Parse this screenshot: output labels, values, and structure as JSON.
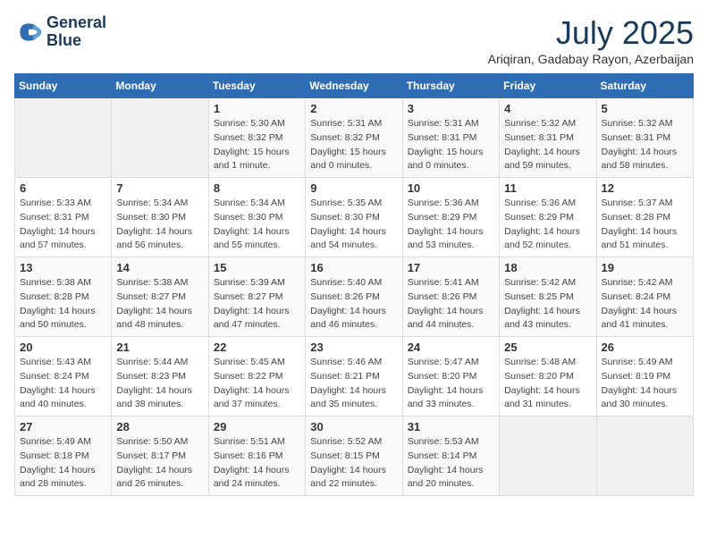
{
  "logo": {
    "line1": "General",
    "line2": "Blue"
  },
  "title": "July 2025",
  "subtitle": "Ariqiran, Gadabay Rayon, Azerbaijan",
  "days_header": [
    "Sunday",
    "Monday",
    "Tuesday",
    "Wednesday",
    "Thursday",
    "Friday",
    "Saturday"
  ],
  "weeks": [
    [
      {
        "num": "",
        "sunrise": "",
        "sunset": "",
        "daylight": ""
      },
      {
        "num": "",
        "sunrise": "",
        "sunset": "",
        "daylight": ""
      },
      {
        "num": "1",
        "sunrise": "Sunrise: 5:30 AM",
        "sunset": "Sunset: 8:32 PM",
        "daylight": "Daylight: 15 hours and 1 minute."
      },
      {
        "num": "2",
        "sunrise": "Sunrise: 5:31 AM",
        "sunset": "Sunset: 8:32 PM",
        "daylight": "Daylight: 15 hours and 0 minutes."
      },
      {
        "num": "3",
        "sunrise": "Sunrise: 5:31 AM",
        "sunset": "Sunset: 8:31 PM",
        "daylight": "Daylight: 15 hours and 0 minutes."
      },
      {
        "num": "4",
        "sunrise": "Sunrise: 5:32 AM",
        "sunset": "Sunset: 8:31 PM",
        "daylight": "Daylight: 14 hours and 59 minutes."
      },
      {
        "num": "5",
        "sunrise": "Sunrise: 5:32 AM",
        "sunset": "Sunset: 8:31 PM",
        "daylight": "Daylight: 14 hours and 58 minutes."
      }
    ],
    [
      {
        "num": "6",
        "sunrise": "Sunrise: 5:33 AM",
        "sunset": "Sunset: 8:31 PM",
        "daylight": "Daylight: 14 hours and 57 minutes."
      },
      {
        "num": "7",
        "sunrise": "Sunrise: 5:34 AM",
        "sunset": "Sunset: 8:30 PM",
        "daylight": "Daylight: 14 hours and 56 minutes."
      },
      {
        "num": "8",
        "sunrise": "Sunrise: 5:34 AM",
        "sunset": "Sunset: 8:30 PM",
        "daylight": "Daylight: 14 hours and 55 minutes."
      },
      {
        "num": "9",
        "sunrise": "Sunrise: 5:35 AM",
        "sunset": "Sunset: 8:30 PM",
        "daylight": "Daylight: 14 hours and 54 minutes."
      },
      {
        "num": "10",
        "sunrise": "Sunrise: 5:36 AM",
        "sunset": "Sunset: 8:29 PM",
        "daylight": "Daylight: 14 hours and 53 minutes."
      },
      {
        "num": "11",
        "sunrise": "Sunrise: 5:36 AM",
        "sunset": "Sunset: 8:29 PM",
        "daylight": "Daylight: 14 hours and 52 minutes."
      },
      {
        "num": "12",
        "sunrise": "Sunrise: 5:37 AM",
        "sunset": "Sunset: 8:28 PM",
        "daylight": "Daylight: 14 hours and 51 minutes."
      }
    ],
    [
      {
        "num": "13",
        "sunrise": "Sunrise: 5:38 AM",
        "sunset": "Sunset: 8:28 PM",
        "daylight": "Daylight: 14 hours and 50 minutes."
      },
      {
        "num": "14",
        "sunrise": "Sunrise: 5:38 AM",
        "sunset": "Sunset: 8:27 PM",
        "daylight": "Daylight: 14 hours and 48 minutes."
      },
      {
        "num": "15",
        "sunrise": "Sunrise: 5:39 AM",
        "sunset": "Sunset: 8:27 PM",
        "daylight": "Daylight: 14 hours and 47 minutes."
      },
      {
        "num": "16",
        "sunrise": "Sunrise: 5:40 AM",
        "sunset": "Sunset: 8:26 PM",
        "daylight": "Daylight: 14 hours and 46 minutes."
      },
      {
        "num": "17",
        "sunrise": "Sunrise: 5:41 AM",
        "sunset": "Sunset: 8:26 PM",
        "daylight": "Daylight: 14 hours and 44 minutes."
      },
      {
        "num": "18",
        "sunrise": "Sunrise: 5:42 AM",
        "sunset": "Sunset: 8:25 PM",
        "daylight": "Daylight: 14 hours and 43 minutes."
      },
      {
        "num": "19",
        "sunrise": "Sunrise: 5:42 AM",
        "sunset": "Sunset: 8:24 PM",
        "daylight": "Daylight: 14 hours and 41 minutes."
      }
    ],
    [
      {
        "num": "20",
        "sunrise": "Sunrise: 5:43 AM",
        "sunset": "Sunset: 8:24 PM",
        "daylight": "Daylight: 14 hours and 40 minutes."
      },
      {
        "num": "21",
        "sunrise": "Sunrise: 5:44 AM",
        "sunset": "Sunset: 8:23 PM",
        "daylight": "Daylight: 14 hours and 38 minutes."
      },
      {
        "num": "22",
        "sunrise": "Sunrise: 5:45 AM",
        "sunset": "Sunset: 8:22 PM",
        "daylight": "Daylight: 14 hours and 37 minutes."
      },
      {
        "num": "23",
        "sunrise": "Sunrise: 5:46 AM",
        "sunset": "Sunset: 8:21 PM",
        "daylight": "Daylight: 14 hours and 35 minutes."
      },
      {
        "num": "24",
        "sunrise": "Sunrise: 5:47 AM",
        "sunset": "Sunset: 8:20 PM",
        "daylight": "Daylight: 14 hours and 33 minutes."
      },
      {
        "num": "25",
        "sunrise": "Sunrise: 5:48 AM",
        "sunset": "Sunset: 8:20 PM",
        "daylight": "Daylight: 14 hours and 31 minutes."
      },
      {
        "num": "26",
        "sunrise": "Sunrise: 5:49 AM",
        "sunset": "Sunset: 8:19 PM",
        "daylight": "Daylight: 14 hours and 30 minutes."
      }
    ],
    [
      {
        "num": "27",
        "sunrise": "Sunrise: 5:49 AM",
        "sunset": "Sunset: 8:18 PM",
        "daylight": "Daylight: 14 hours and 28 minutes."
      },
      {
        "num": "28",
        "sunrise": "Sunrise: 5:50 AM",
        "sunset": "Sunset: 8:17 PM",
        "daylight": "Daylight: 14 hours and 26 minutes."
      },
      {
        "num": "29",
        "sunrise": "Sunrise: 5:51 AM",
        "sunset": "Sunset: 8:16 PM",
        "daylight": "Daylight: 14 hours and 24 minutes."
      },
      {
        "num": "30",
        "sunrise": "Sunrise: 5:52 AM",
        "sunset": "Sunset: 8:15 PM",
        "daylight": "Daylight: 14 hours and 22 minutes."
      },
      {
        "num": "31",
        "sunrise": "Sunrise: 5:53 AM",
        "sunset": "Sunset: 8:14 PM",
        "daylight": "Daylight: 14 hours and 20 minutes."
      },
      {
        "num": "",
        "sunrise": "",
        "sunset": "",
        "daylight": ""
      },
      {
        "num": "",
        "sunrise": "",
        "sunset": "",
        "daylight": ""
      }
    ]
  ]
}
